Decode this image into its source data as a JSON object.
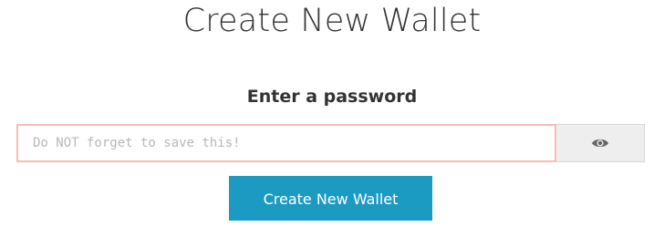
{
  "header": {
    "title": "Create New Wallet"
  },
  "form": {
    "prompt": "Enter a password",
    "password": {
      "value": "",
      "placeholder": "Do NOT forget to save this!"
    },
    "toggle_visibility_icon": "eye-icon",
    "submit_label": "Create New Wallet"
  },
  "colors": {
    "accent": "#1b9ac2",
    "input_border": "#f5bcb7",
    "toggle_bg": "#eeeeee"
  }
}
